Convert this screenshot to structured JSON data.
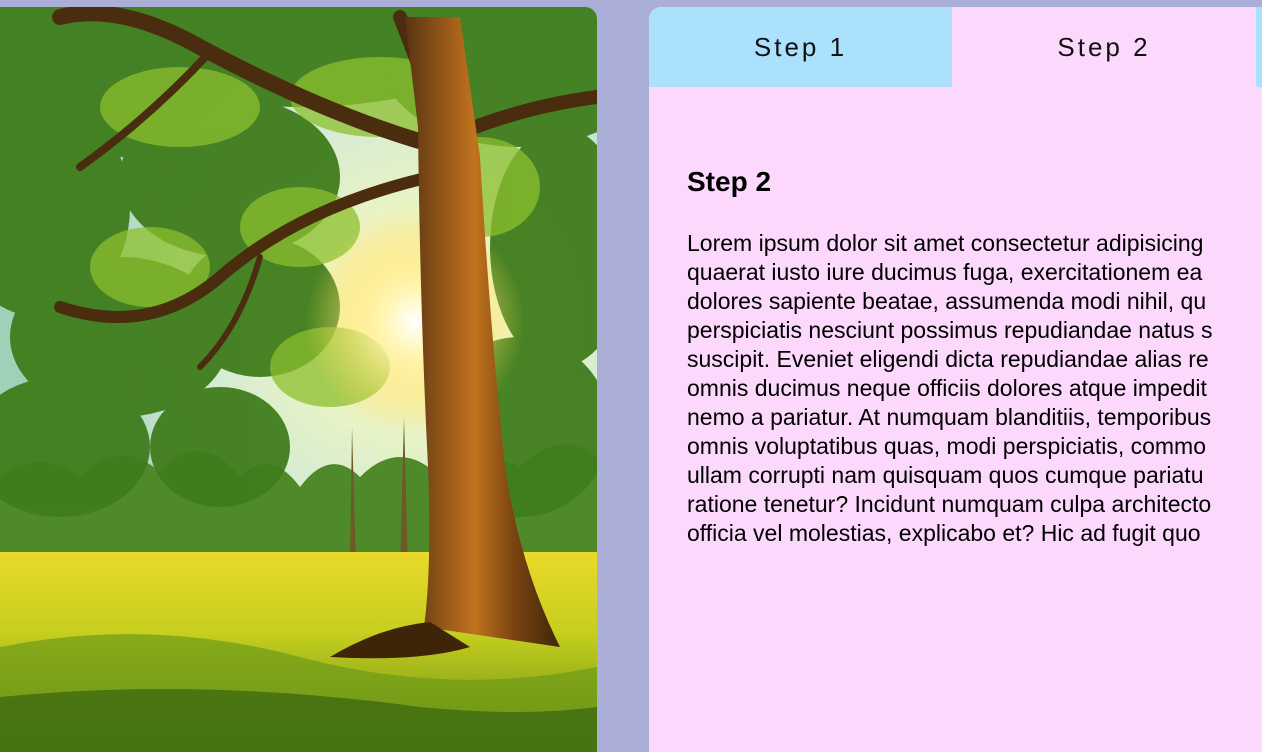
{
  "image": {
    "alt_subject": "sunlit-tree-meadow"
  },
  "tabs": [
    {
      "label": "Step 1",
      "active": false
    },
    {
      "label": "Step 2",
      "active": true
    },
    {
      "label": "",
      "active": false
    }
  ],
  "panel": {
    "heading": "Step 2",
    "body": "Lorem ipsum dolor sit amet consectetur adipisicing\nquaerat iusto iure ducimus fuga, exercitationem ea\ndolores sapiente beatae, assumenda modi nihil, qu\nperspiciatis nesciunt possimus repudiandae natus s\nsuscipit. Eveniet eligendi dicta repudiandae alias re\nomnis ducimus neque officiis dolores atque impedit\nnemo a pariatur. At numquam blanditiis, temporibus\nomnis voluptatibus quas, modi perspiciatis, commo\nullam corrupti nam quisquam quos cumque pariatu\nratione tenetur? Incidunt numquam culpa architecto\nofficia vel molestias, explicabo et? Hic ad fugit quo"
  },
  "colors": {
    "page_bg": "#abaed6",
    "panel_bg": "#fcd9fc",
    "tab_inactive_bg": "#abe1fd",
    "tab_active_bg": "#fcd9fc"
  }
}
